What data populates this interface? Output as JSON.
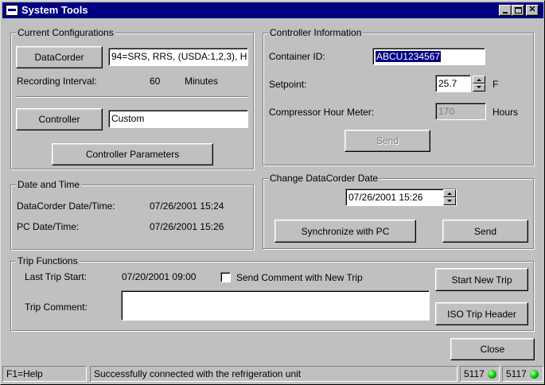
{
  "window": {
    "title": "System Tools"
  },
  "current_config": {
    "legend": "Current Configurations",
    "datacorder_button": "DataCorder",
    "datacorder_value": "94=SRS, RRS, (USDA:1,2,3), H",
    "recording_interval_label": "Recording Interval:",
    "recording_interval_value": "60",
    "recording_interval_unit": "Minutes",
    "controller_button": "Controller",
    "controller_value": "Custom",
    "controller_params_button": "Controller Parameters"
  },
  "date_time": {
    "legend": "Date and Time",
    "datacorder_label": "DataCorder Date/Time:",
    "datacorder_value": "07/26/2001 15:24",
    "pc_label": "PC Date/Time:",
    "pc_value": "07/26/2001 15:26"
  },
  "controller_info": {
    "legend": "Controller Information",
    "container_id_label": "Container ID:",
    "container_id_value": "ABCU1234567",
    "setpoint_label": "Setpoint:",
    "setpoint_value": "25.7",
    "setpoint_unit": "F",
    "compressor_label": "Compressor Hour Meter:",
    "compressor_value": "170",
    "compressor_unit": "Hours",
    "send_button": "Send"
  },
  "change_date": {
    "legend": "Change DataCorder Date",
    "date_value": "07/26/2001 15:26",
    "sync_button": "Synchronize with PC",
    "send_button": "Send"
  },
  "trip": {
    "legend": "Trip Functions",
    "last_start_label": "Last Trip Start:",
    "last_start_value": "07/20/2001 09:00",
    "send_comment_label": "Send Comment with New Trip",
    "comment_label": "Trip Comment:",
    "comment_value": "",
    "start_new_button": "Start New Trip",
    "iso_button": "ISO Trip Header"
  },
  "close_button": "Close",
  "status_bar": {
    "help": "F1=Help",
    "message": "Successfully connected with the refrigeration unit",
    "port1": "5117",
    "port2": "5117"
  },
  "colors": {
    "title_bar": "#000080",
    "face": "#c0c0c0",
    "led": "#00c000"
  }
}
